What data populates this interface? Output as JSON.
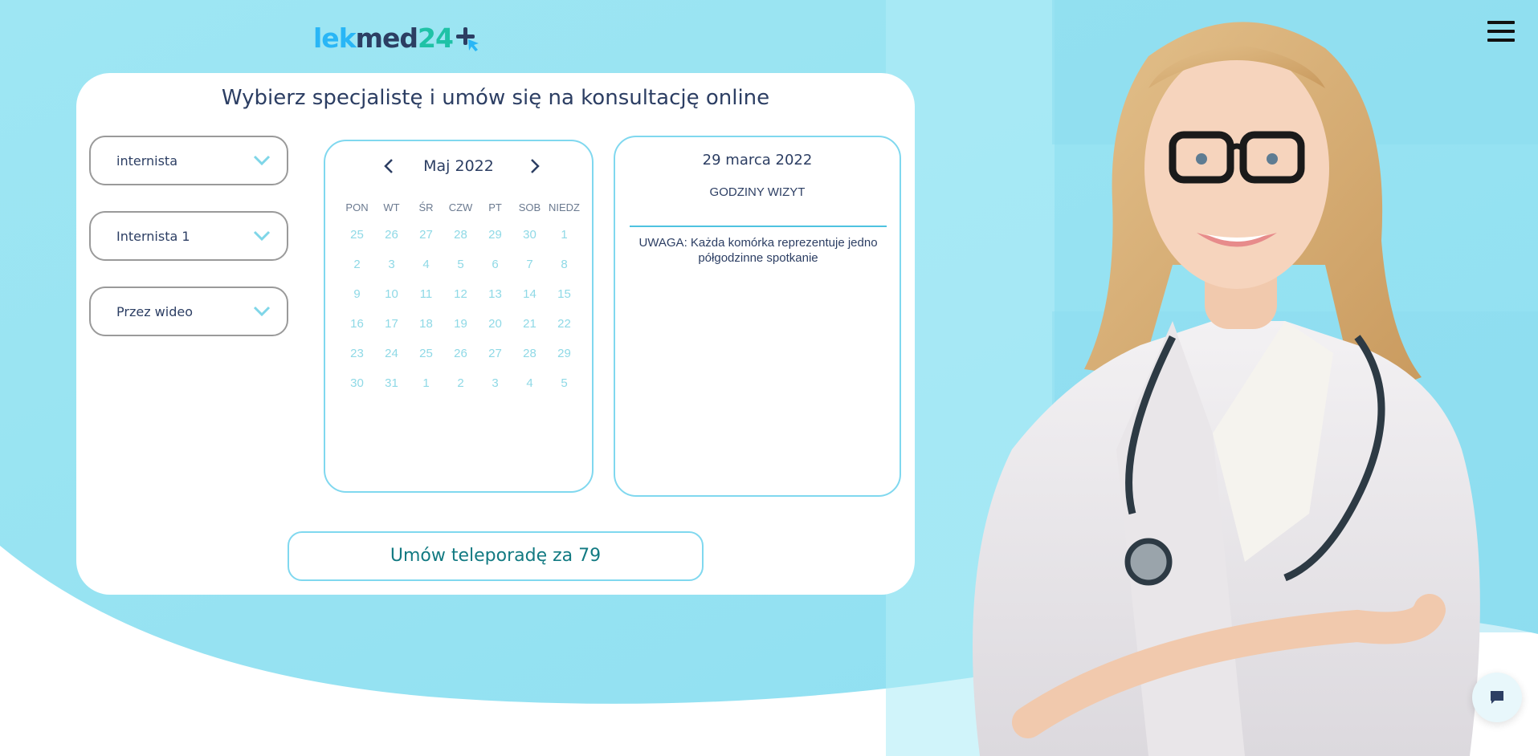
{
  "header": {
    "logo": {
      "part1": "lek",
      "part2": "med",
      "part3": "24"
    }
  },
  "form": {
    "title": "Wybierz specjalistę i umów się na konsultację online",
    "selects": [
      {
        "value": "internista"
      },
      {
        "value": "Internista 1"
      },
      {
        "value": "Przez wideo"
      }
    ]
  },
  "calendar": {
    "month": "Maj 2022",
    "weekdays": [
      "PON",
      "WT",
      "ŚR",
      "CZW",
      "PT",
      "SOB",
      "NIEDZ"
    ],
    "weeks": [
      [
        "25",
        "26",
        "27",
        "28",
        "29",
        "30",
        "1"
      ],
      [
        "2",
        "3",
        "4",
        "5",
        "6",
        "7",
        "8"
      ],
      [
        "9",
        "10",
        "11",
        "12",
        "13",
        "14",
        "15"
      ],
      [
        "16",
        "17",
        "18",
        "19",
        "20",
        "21",
        "22"
      ],
      [
        "23",
        "24",
        "25",
        "26",
        "27",
        "28",
        "29"
      ],
      [
        "30",
        "31",
        "1",
        "2",
        "3",
        "4",
        "5"
      ]
    ]
  },
  "hours": {
    "date": "29 marca 2022",
    "title": "GODZINY WIZYT",
    "note": "UWAGA: Każda komórka reprezentuje jedno półgodzinne spotkanie"
  },
  "cta": {
    "label": "Umów teleporadę za 79"
  },
  "colors": {
    "accent": "#80d8ef",
    "navy": "#2c3e63",
    "teal": "#127a82",
    "sky": "#99e5f3"
  },
  "icons": [
    "menu-icon",
    "chevron-down-icon",
    "chevron-left-icon",
    "chevron-right-icon",
    "chat-icon",
    "cursor-arrow-icon"
  ]
}
